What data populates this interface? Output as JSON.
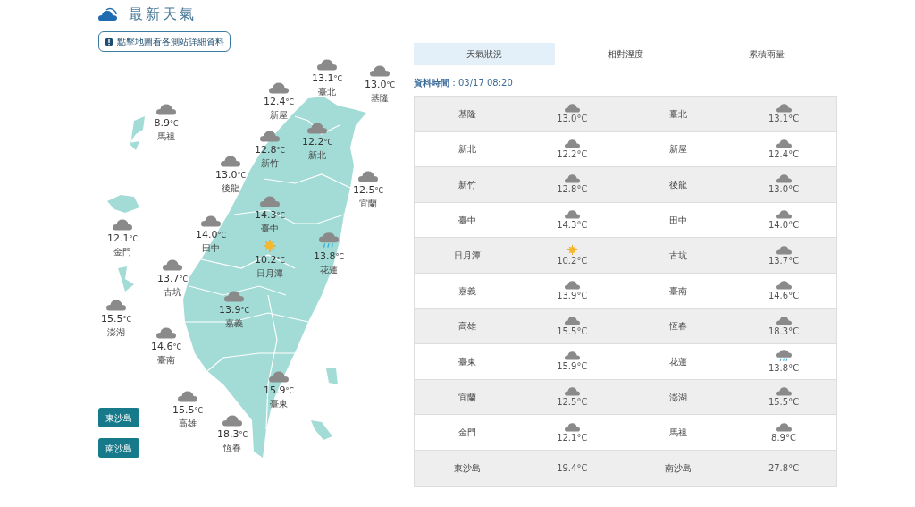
{
  "header": {
    "title": "最新天氣"
  },
  "notice": {
    "text": "點擊地圖看各測站詳細資料"
  },
  "map": {
    "stations": [
      {
        "name": "臺北",
        "temp": "13.1",
        "unit": "°C",
        "kind": "cloudy"
      },
      {
        "name": "基隆",
        "temp": "13.0",
        "unit": "°C",
        "kind": "cloudy"
      },
      {
        "name": "新屋",
        "temp": "12.4",
        "unit": "°C",
        "kind": "cloudy"
      },
      {
        "name": "馬祖",
        "temp": "8.9",
        "unit": "°C",
        "kind": "cloudy"
      },
      {
        "name": "新北",
        "temp": "12.2",
        "unit": "°C",
        "kind": "cloudy"
      },
      {
        "name": "新竹",
        "temp": "12.8",
        "unit": "°C",
        "kind": "cloudy"
      },
      {
        "name": "後龍",
        "temp": "13.0",
        "unit": "°C",
        "kind": "cloudy"
      },
      {
        "name": "宜蘭",
        "temp": "12.5",
        "unit": "°C",
        "kind": "cloudy"
      },
      {
        "name": "臺中",
        "temp": "14.3",
        "unit": "°C",
        "kind": "cloudy"
      },
      {
        "name": "田中",
        "temp": "14.0",
        "unit": "°C",
        "kind": "cloudy"
      },
      {
        "name": "金門",
        "temp": "12.1",
        "unit": "°C",
        "kind": "cloudy"
      },
      {
        "name": "日月潭",
        "temp": "10.2",
        "unit": "°C",
        "kind": "sunny"
      },
      {
        "name": "花蓮",
        "temp": "13.8",
        "unit": "°C",
        "kind": "rain"
      },
      {
        "name": "古坑",
        "temp": "13.7",
        "unit": "°C",
        "kind": "cloudy"
      },
      {
        "name": "澎湖",
        "temp": "15.5",
        "unit": "°C",
        "kind": "cloudy"
      },
      {
        "name": "嘉義",
        "temp": "13.9",
        "unit": "°C",
        "kind": "cloudy"
      },
      {
        "name": "臺南",
        "temp": "14.6",
        "unit": "°C",
        "kind": "cloudy"
      },
      {
        "name": "臺東",
        "temp": "15.9",
        "unit": "°C",
        "kind": "cloudy"
      },
      {
        "name": "高雄",
        "temp": "15.5",
        "unit": "°C",
        "kind": "cloudy"
      },
      {
        "name": "恆春",
        "temp": "18.3",
        "unit": "°C",
        "kind": "cloudy"
      }
    ],
    "island_buttons": [
      "東沙島",
      "南沙島"
    ]
  },
  "tabs": [
    {
      "label": "天氣狀況",
      "selected": true
    },
    {
      "label": "相對溼度",
      "selected": false
    },
    {
      "label": "累積雨量",
      "selected": false
    }
  ],
  "data_time": {
    "label": "資料時間",
    "value": "：03/17 08:20"
  },
  "table": {
    "rows": [
      {
        "cells": [
          {
            "name": "基隆",
            "temp": "13.0°C",
            "kind": "cloudy"
          },
          {
            "name": "臺北",
            "temp": "13.1°C",
            "kind": "cloudy"
          }
        ]
      },
      {
        "cells": [
          {
            "name": "新北",
            "temp": "12.2°C",
            "kind": "cloudy"
          },
          {
            "name": "新屋",
            "temp": "12.4°C",
            "kind": "cloudy"
          }
        ]
      },
      {
        "cells": [
          {
            "name": "新竹",
            "temp": "12.8°C",
            "kind": "cloudy"
          },
          {
            "name": "後龍",
            "temp": "13.0°C",
            "kind": "cloudy"
          }
        ]
      },
      {
        "cells": [
          {
            "name": "臺中",
            "temp": "14.3°C",
            "kind": "cloudy"
          },
          {
            "name": "田中",
            "temp": "14.0°C",
            "kind": "cloudy"
          }
        ]
      },
      {
        "cells": [
          {
            "name": "日月潭",
            "temp": "10.2°C",
            "kind": "sunny"
          },
          {
            "name": "古坑",
            "temp": "13.7°C",
            "kind": "cloudy"
          }
        ]
      },
      {
        "cells": [
          {
            "name": "嘉義",
            "temp": "13.9°C",
            "kind": "cloudy"
          },
          {
            "name": "臺南",
            "temp": "14.6°C",
            "kind": "cloudy"
          }
        ]
      },
      {
        "cells": [
          {
            "name": "高雄",
            "temp": "15.5°C",
            "kind": "cloudy"
          },
          {
            "name": "恆春",
            "temp": "18.3°C",
            "kind": "cloudy"
          }
        ]
      },
      {
        "cells": [
          {
            "name": "臺東",
            "temp": "15.9°C",
            "kind": "cloudy"
          },
          {
            "name": "花蓮",
            "temp": "13.8°C",
            "kind": "rain"
          }
        ]
      },
      {
        "cells": [
          {
            "name": "宜蘭",
            "temp": "12.5°C",
            "kind": "cloudy"
          },
          {
            "name": "澎湖",
            "temp": "15.5°C",
            "kind": "cloudy"
          }
        ]
      },
      {
        "cells": [
          {
            "name": "金門",
            "temp": "12.1°C",
            "kind": "cloudy"
          },
          {
            "name": "馬祖",
            "temp": "8.9°C",
            "kind": "cloudy"
          }
        ]
      },
      {
        "cells": [
          {
            "name": "東沙島",
            "temp": "19.4°C",
            "kind": "none"
          },
          {
            "name": "南沙島",
            "temp": "27.8°C",
            "kind": "none"
          }
        ]
      }
    ]
  }
}
